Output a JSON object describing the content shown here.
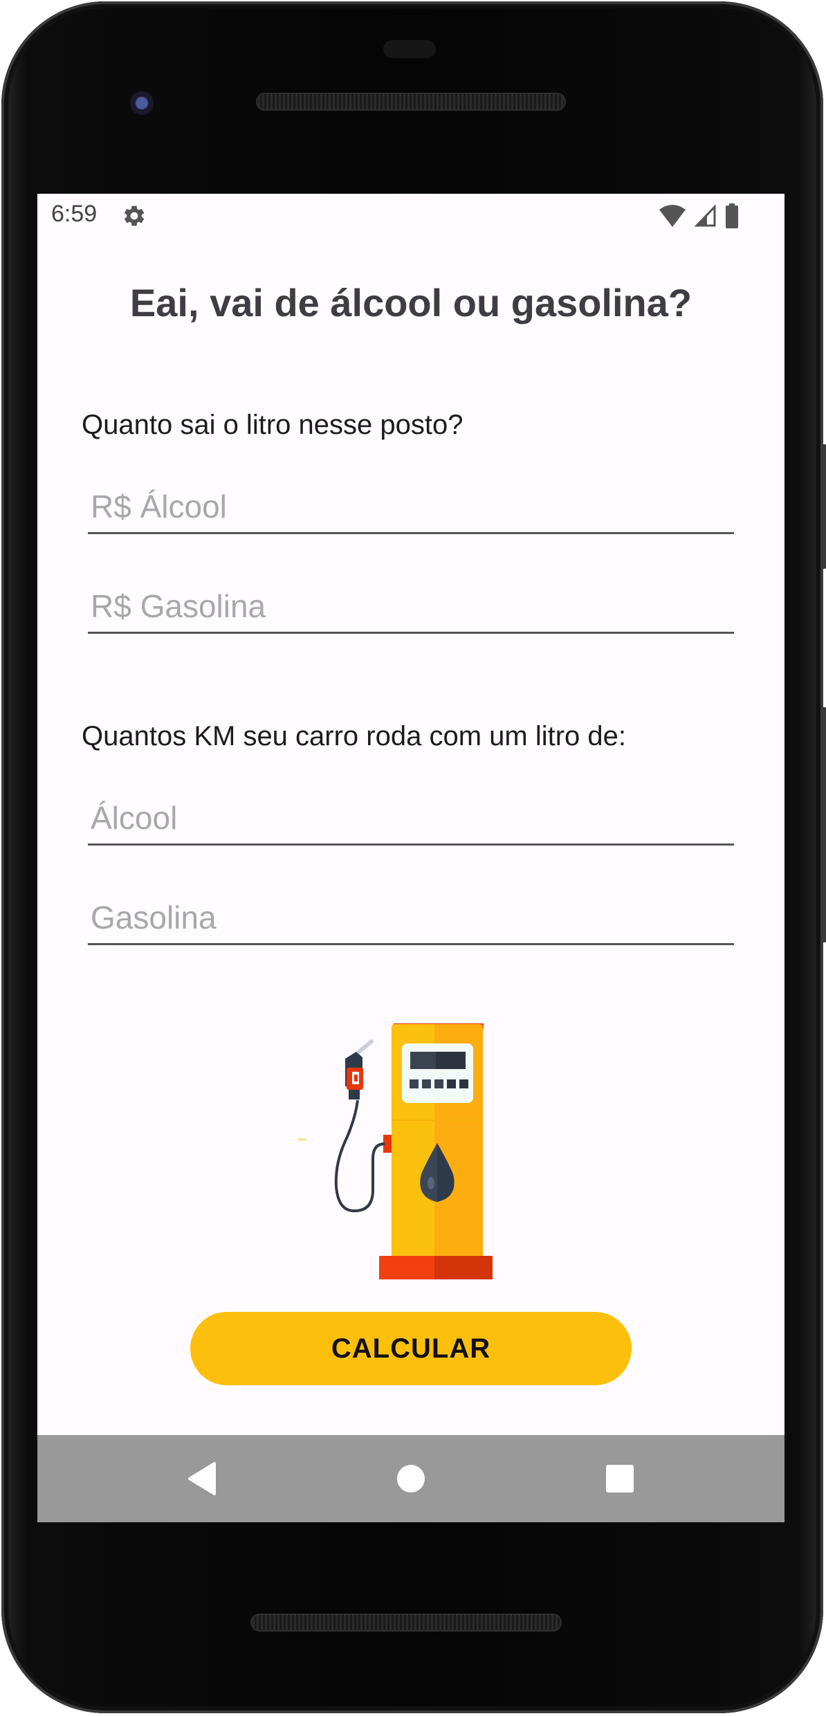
{
  "status_bar": {
    "time": "6:59",
    "settings_icon": "gear-icon",
    "wifi_icon": "wifi-icon",
    "signal_icon": "cell-signal-icon",
    "battery_icon": "battery-icon"
  },
  "app": {
    "title": "Eai, vai de álcool ou gasolina?",
    "price_section": {
      "label": "Quanto sai o litro nesse posto?",
      "alcohol_placeholder": "R$ Álcool",
      "alcohol_value": "",
      "gasoline_placeholder": "R$ Gasolina",
      "gasoline_value": ""
    },
    "consumption_section": {
      "label": "Quantos KM seu carro roda com um litro de:",
      "alcohol_placeholder": "Álcool",
      "alcohol_value": "",
      "gasoline_placeholder": "Gasolina",
      "gasoline_value": ""
    },
    "illustration_icon": "fuel-pump-icon",
    "calculate_label": "CALCULAR"
  },
  "nav_bar": {
    "back_icon": "back-triangle-icon",
    "home_icon": "home-circle-icon",
    "recents_icon": "recents-square-icon"
  },
  "colors": {
    "accent": "#fcbf0b",
    "background": "#fffbfe",
    "title_text": "#3f3d44",
    "nav_bar": "#999999"
  }
}
